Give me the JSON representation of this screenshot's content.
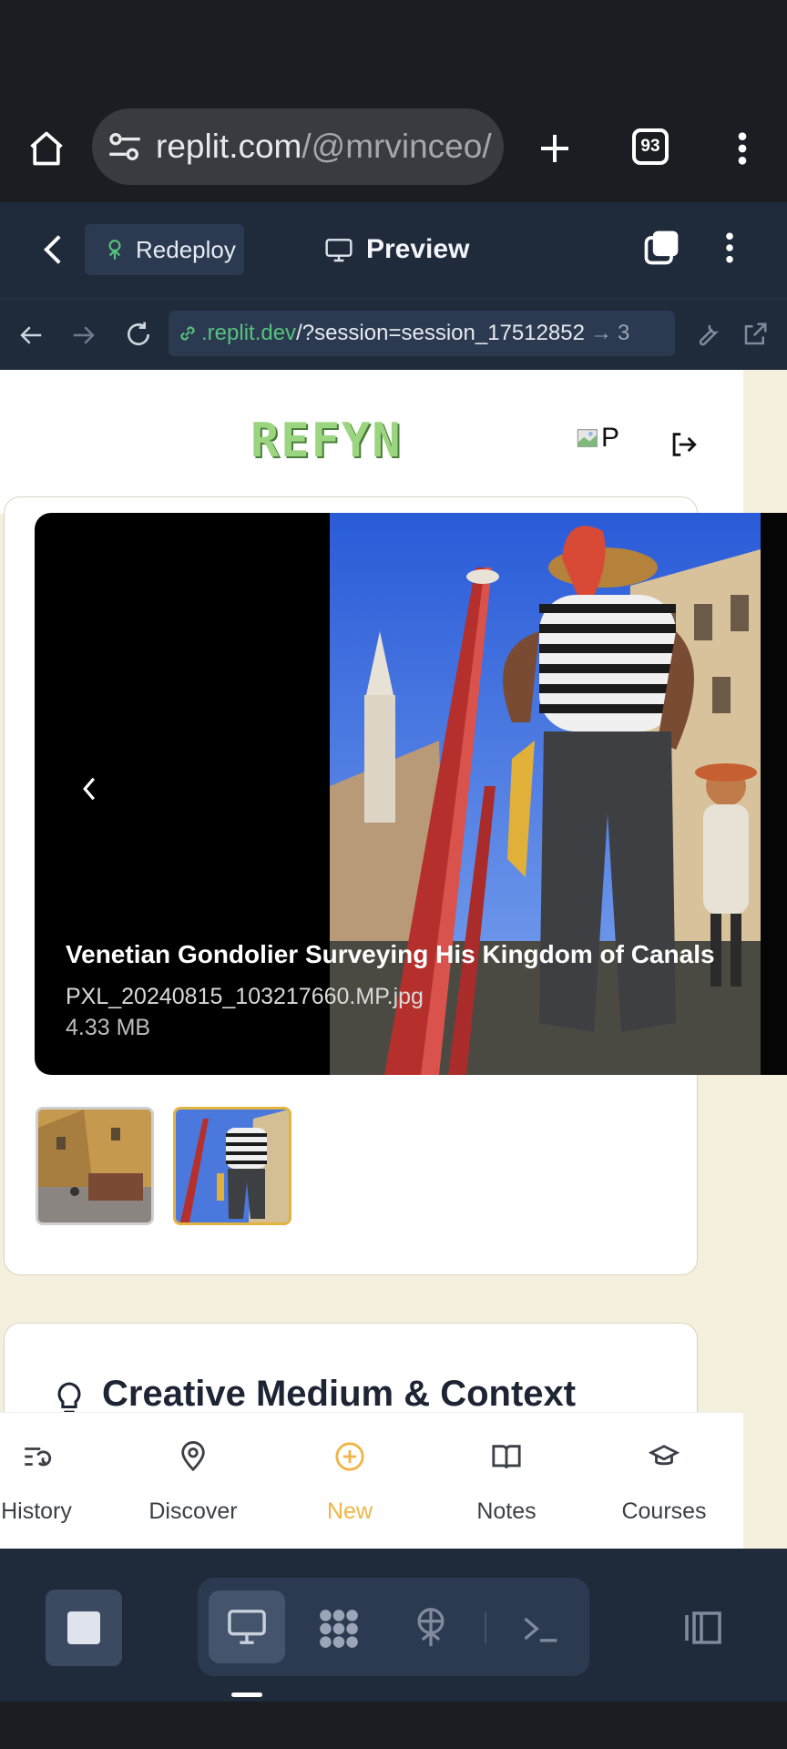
{
  "browser": {
    "url_host": "replit.com",
    "url_path": "/@mrvinceo/R",
    "tab_count": "93"
  },
  "replit": {
    "redeploy_label": "Redeploy",
    "preview_label": "Preview",
    "address_host": ".replit.dev",
    "address_path": "/?session=session_17512852",
    "address_suffix": "3"
  },
  "site": {
    "logo": "REFYN",
    "avatar_alt": "P"
  },
  "viewer": {
    "title": "Venetian Gondolier Surveying His Kingdom of Canals",
    "filename": "PXL_20240815_103217660.MP.jpg",
    "filesize": "4.33 MB",
    "selected_thumb": 2
  },
  "section": {
    "title": "Creative Medium & Context"
  },
  "bottom_nav": {
    "items": [
      {
        "label": "History",
        "icon": "history-icon"
      },
      {
        "label": "Discover",
        "icon": "map-pin-icon"
      },
      {
        "label": "New",
        "icon": "plus-circle-icon",
        "active": true
      },
      {
        "label": "Notes",
        "icon": "book-icon"
      },
      {
        "label": "Courses",
        "icon": "graduation-cap-icon"
      }
    ],
    "active_color": "#f0b545"
  },
  "colors": {
    "accent_green": "#57c17d",
    "page_bg": "#f5efdd",
    "replit_bg": "#1f2a3b"
  }
}
